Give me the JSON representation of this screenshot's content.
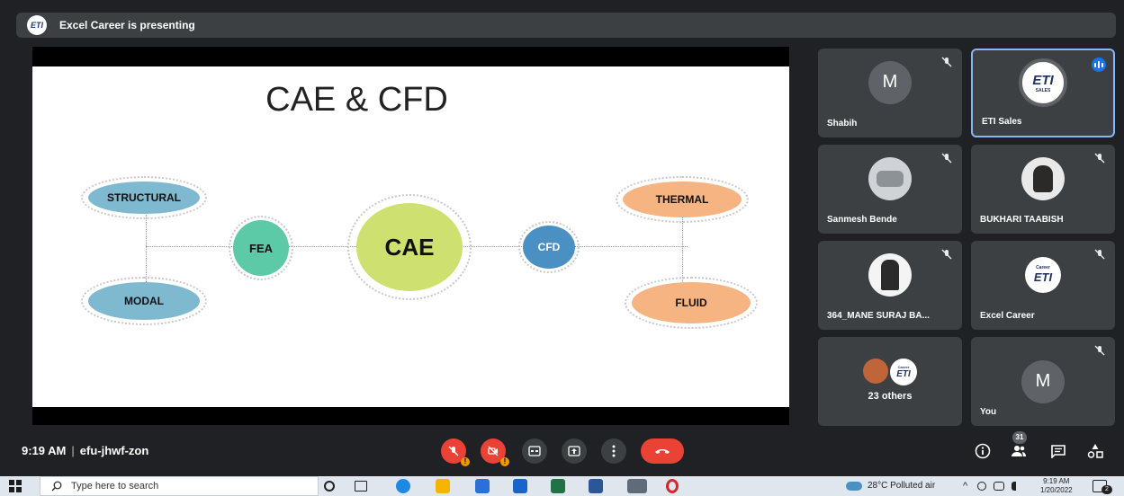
{
  "banner": {
    "logo_text": "ETI",
    "text": "Excel Career is presenting"
  },
  "slide": {
    "title": "CAE & CFD",
    "nodes": {
      "structural": "STRUCTURAL",
      "modal": "MODAL",
      "fea": "FEA",
      "cae": "CAE",
      "cfd": "CFD",
      "thermal": "THERMAL",
      "fluid": "FLUID"
    },
    "colors": {
      "structural": "#7fb9cf",
      "modal": "#7fb9cf",
      "fea": "#5cc9a7",
      "cae": "#cde070",
      "cfd": "#4a90c2",
      "thermal": "#f6b483",
      "fluid": "#f6b483"
    }
  },
  "participants": [
    {
      "name": "Shabih",
      "avatar": "M",
      "muted": true
    },
    {
      "name": "ETI Sales",
      "avatar": "ETI",
      "avatar_sub": "SALES",
      "speaking": true
    },
    {
      "name": "Sanmesh Bende",
      "avatar": "photo",
      "muted": true
    },
    {
      "name": "BUKHARI TAABISH",
      "avatar": "photo",
      "muted": true
    },
    {
      "name": "364_MANE SURAJ BA...",
      "avatar": "photo",
      "muted": true
    },
    {
      "name": "Excel Career",
      "avatar": "ETI",
      "avatar_sub": "Career",
      "muted": true
    },
    {
      "name": "23 others",
      "avatar": "group",
      "avatar_text": "ETI",
      "avatar_sub": "Career"
    },
    {
      "name": "You",
      "avatar": "M",
      "muted": true
    }
  ],
  "bottombar": {
    "time": "9:19 AM",
    "separator": "|",
    "meeting_code": "efu-jhwf-zon",
    "people_count": "31",
    "controls": [
      "microphone-off",
      "camera-off",
      "captions",
      "present",
      "more",
      "end-call"
    ],
    "right": [
      "info",
      "people",
      "chat",
      "activities"
    ]
  },
  "taskbar": {
    "search_placeholder": "Type here to search",
    "weather": "28°C  Polluted air",
    "clock_time": "9:19 AM",
    "clock_date": "1/20/2022",
    "notifications": "2"
  }
}
